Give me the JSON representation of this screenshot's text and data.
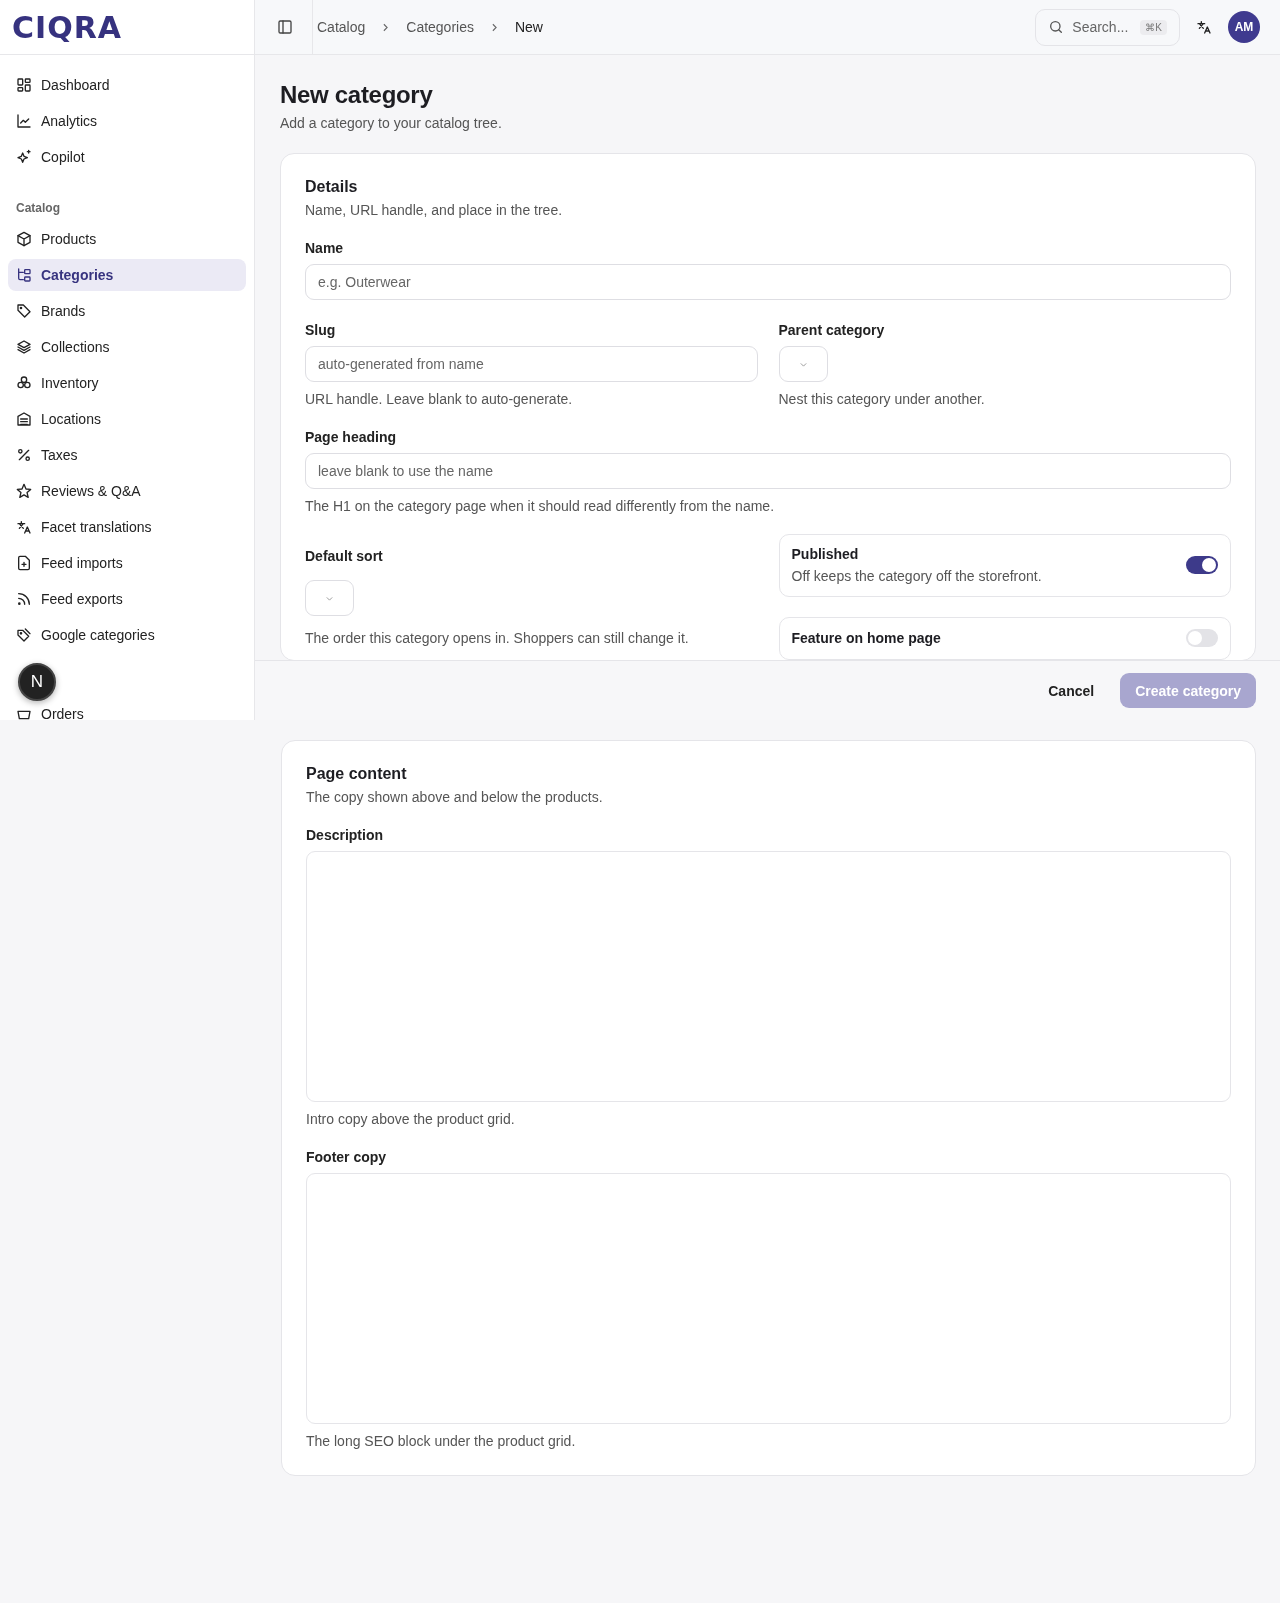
{
  "logo": "CIQRA",
  "sidebar": {
    "top_items": [
      {
        "label": "Dashboard",
        "selected": false
      },
      {
        "label": "Analytics",
        "selected": false
      },
      {
        "label": "Copilot",
        "selected": false
      }
    ],
    "catalog": {
      "title": "Catalog",
      "items": [
        {
          "label": "Products",
          "selected": false
        },
        {
          "label": "Categories",
          "selected": true
        },
        {
          "label": "Brands",
          "selected": false
        },
        {
          "label": "Collections",
          "selected": false
        },
        {
          "label": "Inventory",
          "selected": false
        },
        {
          "label": "Locations",
          "selected": false
        },
        {
          "label": "Taxes",
          "selected": false
        },
        {
          "label": "Reviews & Q&A",
          "selected": false
        },
        {
          "label": "Facet translations",
          "selected": false
        },
        {
          "label": "Feed imports",
          "selected": false
        },
        {
          "label": "Feed exports",
          "selected": false
        },
        {
          "label": "Google categories",
          "selected": false
        }
      ]
    },
    "after_items": [
      {
        "label": "Orders",
        "selected": false
      }
    ]
  },
  "dev_badge": "N",
  "topbar": {
    "breadcrumb": [
      "Catalog",
      "Categories",
      "New"
    ],
    "search": {
      "placeholder": "Search...",
      "shortcut": "⌘K"
    },
    "avatar": "AM"
  },
  "page": {
    "title": "New category",
    "subtitle": "Add a category to your catalog tree."
  },
  "details": {
    "title": "Details",
    "subtitle": "Name, URL handle, and place in the tree.",
    "name": {
      "label": "Name",
      "placeholder": "e.g. Outerwear"
    },
    "slug": {
      "label": "Slug",
      "placeholder": "auto-generated from name",
      "help": "URL handle. Leave blank to auto-generate."
    },
    "parent": {
      "label": "Parent category",
      "help": "Nest this category under another."
    },
    "page_heading": {
      "label": "Page heading",
      "placeholder": "leave blank to use the name",
      "help": "The H1 on the category page when it should read differently from the name."
    },
    "default_sort": {
      "label": "Default sort",
      "help": "The order this category opens in. Shoppers can still change it."
    },
    "toggles": [
      {
        "label": "Published",
        "description": "Off keeps the category off the storefront.",
        "on": true
      },
      {
        "label": "Feature on home page",
        "on": false
      }
    ]
  },
  "footer": {
    "cancel": "Cancel",
    "create": {
      "label": "Create category",
      "disabled": true
    }
  },
  "page_content": {
    "title": "Page content",
    "subtitle": "The copy shown above and below the products.",
    "description": {
      "label": "Description",
      "help": "Intro copy above the product grid."
    },
    "footer_copy": {
      "label": "Footer copy",
      "help": "The long SEO block under the product grid."
    }
  }
}
